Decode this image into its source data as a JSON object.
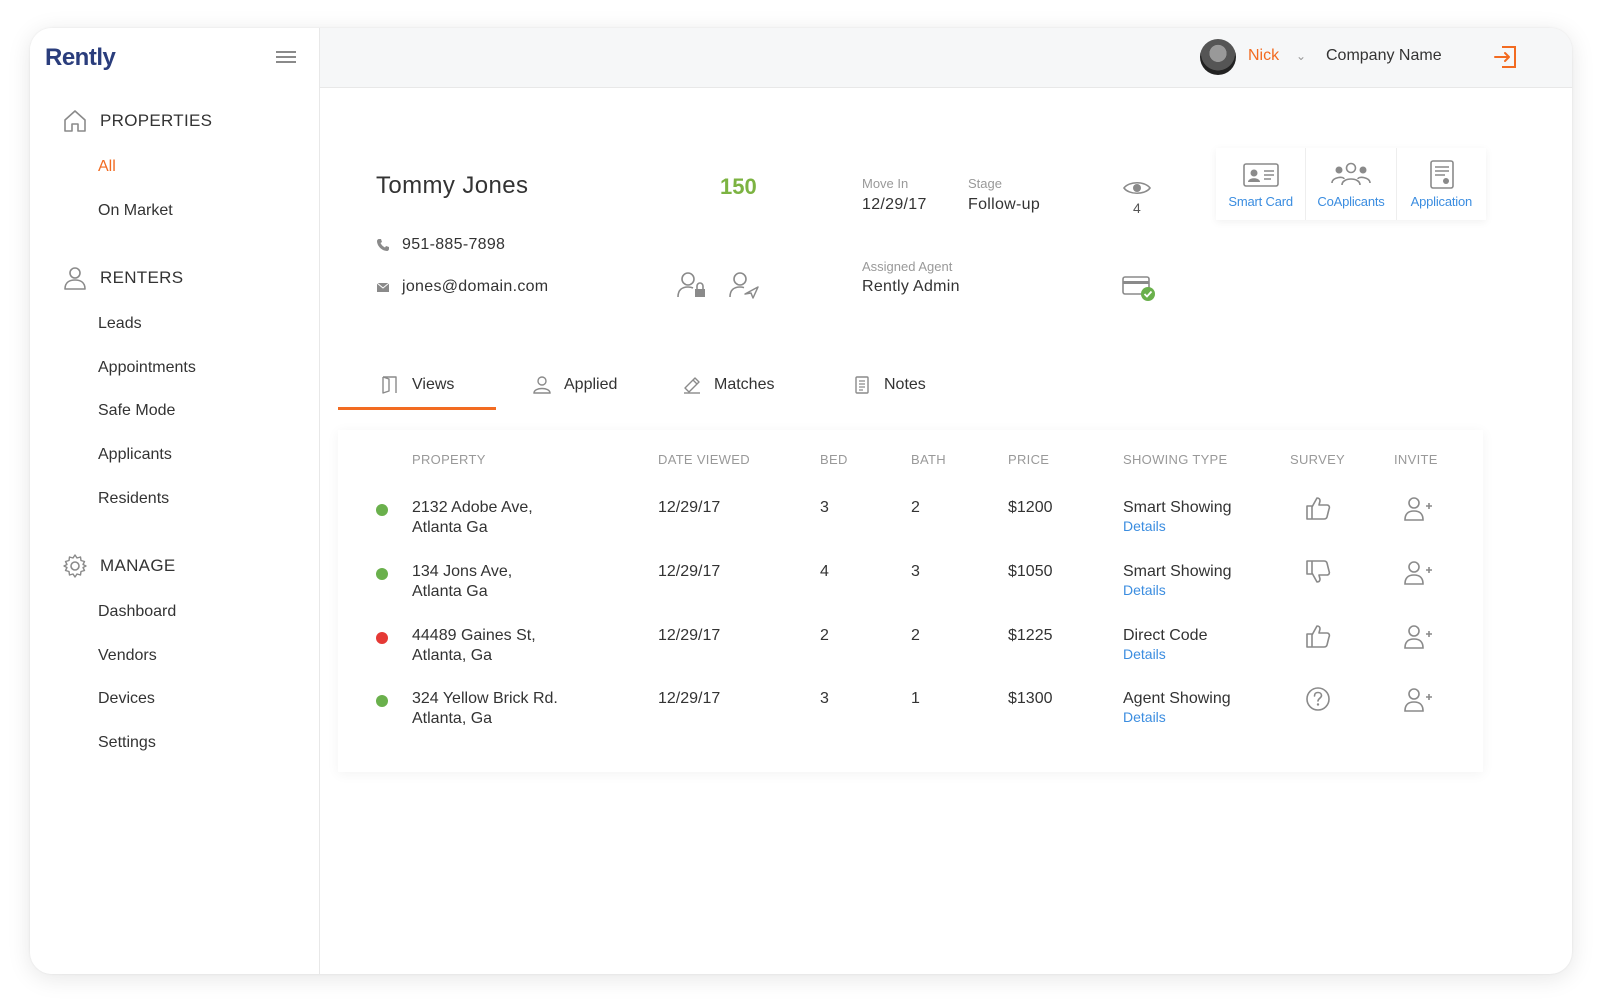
{
  "brand": {
    "logo_text": "Rently",
    "accent": "#f26b21",
    "link": "#3b8de0",
    "score_color": "#7cb342"
  },
  "sidebar": {
    "sections": [
      {
        "title": "PROPERTIES",
        "icon": "home-icon",
        "items": [
          "All",
          "On Market"
        ]
      },
      {
        "title": "RENTERS",
        "icon": "user-icon",
        "items": [
          "Leads",
          "Appointments",
          "Safe Mode",
          "Applicants",
          "Residents"
        ]
      },
      {
        "title": "MANAGE",
        "icon": "gear-icon",
        "items": [
          "Dashboard",
          "Vendors",
          "Devices",
          "Settings"
        ]
      }
    ],
    "active_item": "All"
  },
  "header": {
    "user_name": "Nick",
    "caret": "⌄",
    "company": "Company Name"
  },
  "renter": {
    "name": "Tommy Jones",
    "score": "150",
    "phone": "951-885-7898",
    "email": "jones@domain.com",
    "move_in_label": "Move In",
    "move_in": "12/29/17",
    "stage_label": "Stage",
    "stage": "Follow-up",
    "views": "4",
    "agent_label": "Assigned Agent",
    "agent": "Rently Admin"
  },
  "actions": [
    {
      "label": "Smart Card",
      "icon": "id-card-icon"
    },
    {
      "label": "CoAplicants",
      "icon": "group-icon"
    },
    {
      "label": "Application",
      "icon": "document-icon"
    }
  ],
  "tabs": [
    {
      "label": "Views",
      "icon": "door-icon",
      "active": true
    },
    {
      "label": "Applied",
      "icon": "user-icon",
      "active": false
    },
    {
      "label": "Matches",
      "icon": "matches-icon",
      "active": false
    },
    {
      "label": "Notes",
      "icon": "notes-icon",
      "active": false
    }
  ],
  "table": {
    "headers": [
      "PROPERTY",
      "DATE VIEWED",
      "BED",
      "BATH",
      "PRICE",
      "SHOWING TYPE",
      "SURVEY",
      "INVITE"
    ],
    "details_label": "Details",
    "rows": [
      {
        "status": "#6ab04c",
        "address_1": "2132 Adobe Ave,",
        "address_2": "Atlanta Ga",
        "date": "12/29/17",
        "bed": "3",
        "bath": "2",
        "price": "$1200",
        "showing": "Smart Showing",
        "survey": "thumbs-up-icon"
      },
      {
        "status": "#6ab04c",
        "address_1": "134 Jons Ave,",
        "address_2": "Atlanta Ga",
        "date": "12/29/17",
        "bed": "4",
        "bath": "3",
        "price": "$1050",
        "showing": "Smart Showing",
        "survey": "thumbs-down-icon"
      },
      {
        "status": "#e53935",
        "address_1": "44489 Gaines St,",
        "address_2": "Atlanta, Ga",
        "date": "12/29/17",
        "bed": "2",
        "bath": "2",
        "price": "$1225",
        "showing": "Direct Code",
        "survey": "thumbs-up-icon"
      },
      {
        "status": "#6ab04c",
        "address_1": "324 Yellow Brick Rd.",
        "address_2": "Atlanta, Ga",
        "date": "12/29/17",
        "bed": "3",
        "bath": "1",
        "price": "$1300",
        "showing": "Agent Showing",
        "survey": "question-icon"
      }
    ]
  }
}
